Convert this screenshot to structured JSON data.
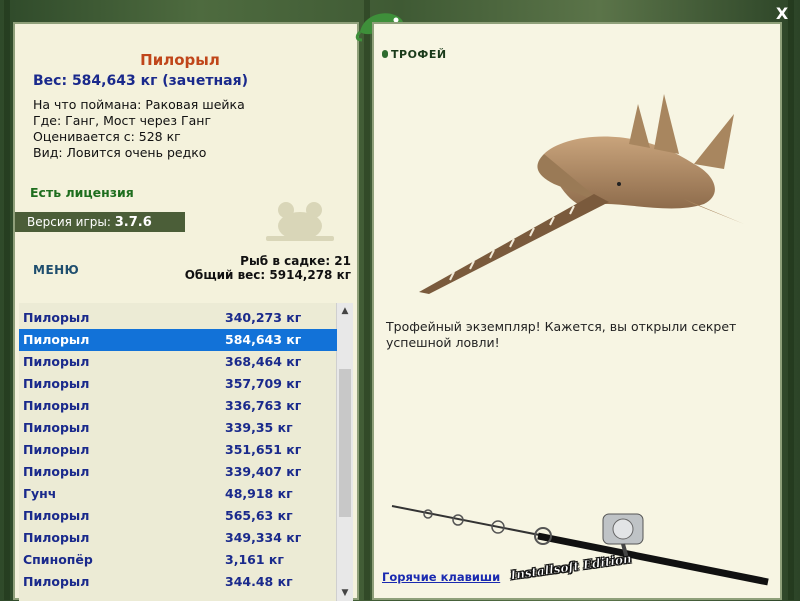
{
  "fish": {
    "name": "Пилорыл",
    "weight": "Вес: 584,643 кг (зачетная)",
    "caught_on": "На что поймана: Раковая шейка",
    "where": "Где: Ганг, Мост через Ганг",
    "valued_from": "Оценивается с: 528 кг",
    "kind": "Вид: Ловится очень редко"
  },
  "license": "Есть лицензия",
  "version": {
    "label": "Версия игры:",
    "value": "3.7.6"
  },
  "menu_label": "МЕНЮ",
  "cage": {
    "count": "Рыб в садке: 21",
    "total": "Общий вес: 5914,278 кг"
  },
  "catch_list": [
    {
      "name": "Пилорыл",
      "weight": "340,273 кг"
    },
    {
      "name": "Пилорыл",
      "weight": "584,643 кг",
      "selected": true
    },
    {
      "name": "Пилорыл",
      "weight": "368,464 кг"
    },
    {
      "name": "Пилорыл",
      "weight": "357,709 кг"
    },
    {
      "name": "Пилорыл",
      "weight": "336,763 кг"
    },
    {
      "name": "Пилорыл",
      "weight": "339,35 кг"
    },
    {
      "name": "Пилорыл",
      "weight": "351,651 кг"
    },
    {
      "name": "Пилорыл",
      "weight": "339,407 кг"
    },
    {
      "name": "Гунч",
      "weight": "48,918 кг"
    },
    {
      "name": "Пилорыл",
      "weight": "565,63 кг"
    },
    {
      "name": "Пилорыл",
      "weight": "349,334 кг"
    },
    {
      "name": "Спинопёр",
      "weight": "3,161 кг"
    },
    {
      "name": "Пилорыл",
      "weight": "344.48 кг"
    }
  ],
  "trophy": {
    "title": "ТРОФЕЙ",
    "description": "Трофейный экземпляр! Кажется, вы открыли секрет успешной ловли!"
  },
  "hotkeys": "Горячие клавиши",
  "watermark": "Installsoft Edition",
  "close_label": "X",
  "icons": {
    "close": "close-icon",
    "scroll_up": "chevron-up-icon",
    "scroll_down": "chevron-down-icon",
    "mascot": "chameleon-icon"
  },
  "colors": {
    "selected_row": "#1272d8",
    "fish_name": "#c0461a",
    "weight_text": "#1a2a8c",
    "license": "#1e6e1e",
    "version_bg": "#4b5e38"
  }
}
